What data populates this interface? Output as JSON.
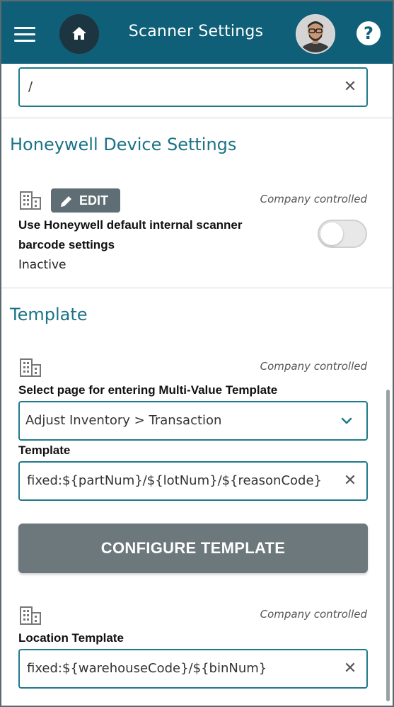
{
  "header": {
    "title": "Scanner Settings",
    "help_label": "?",
    "colors": {
      "bar": "#0f5f78",
      "home_circle": "#1d3540"
    }
  },
  "top_field": {
    "value": "/"
  },
  "honeywell": {
    "title": "Honeywell Device Settings",
    "edit_label": "EDIT",
    "company_controlled": "Company controlled",
    "setting_label_line1": "Use Honeywell default internal scanner",
    "setting_label_line2": "barcode settings",
    "status": "Inactive",
    "toggle_on": false
  },
  "template": {
    "title": "Template",
    "company_controlled": "Company controlled",
    "select_label": "Select page for entering Multi-Value Template",
    "select_value": "Adjust Inventory > Transaction",
    "template_label": "Template",
    "template_value": "fixed:${partNum}/${lotNum}/${reasonCode}",
    "configure_label": "CONFIGURE TEMPLATE"
  },
  "location": {
    "company_controlled": "Company controlled",
    "label": "Location Template",
    "value": "fixed:${warehouseCode}/${binNum}"
  },
  "icons": {
    "menu": "hamburger-icon",
    "home": "home-icon",
    "help": "help-icon",
    "clear": "close-icon",
    "company": "building-icon",
    "edit": "pencil-icon",
    "dropdown": "chevron-down-icon"
  }
}
